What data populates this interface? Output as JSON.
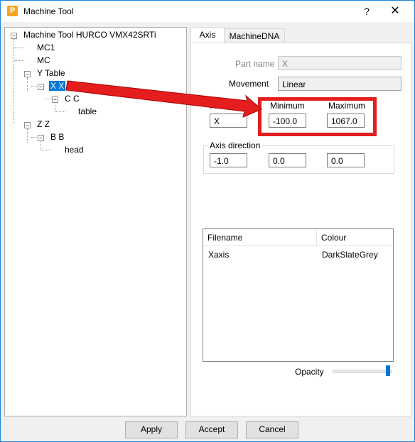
{
  "window": {
    "title": "Machine Tool",
    "help": "?",
    "close": "✕"
  },
  "tree": {
    "root": "Machine Tool HURCO VMX42SRTi",
    "mc1": "MC1",
    "mc": "MC",
    "y_table": "Y Table",
    "x_x": "X X",
    "c_c": "C C",
    "table": "table",
    "z_z": "Z Z",
    "b_b": "B B",
    "head": "head"
  },
  "tabs": {
    "axis": "Axis",
    "machine_dna": "MachineDNA"
  },
  "axis": {
    "part_name_label": "Part name",
    "part_name_value": "X",
    "movement_label": "Movement",
    "movement_value": "Linear",
    "address_label": "Address",
    "address_value": "X",
    "minimum_label": "Minimum",
    "minimum_value": "-100.0",
    "maximum_label": "Maximum",
    "maximum_value": "1067.0",
    "axis_direction_label": "Axis direction",
    "dir_x": "-1.0",
    "dir_y": "0.0",
    "dir_z": "0.0"
  },
  "files_table": {
    "headers": [
      "Filename",
      "Colour"
    ],
    "rows": [
      [
        "Xaxis",
        "DarkSlateGrey"
      ]
    ]
  },
  "opacity": {
    "label": "Opacity",
    "value": 1.0
  },
  "buttons": {
    "apply": "Apply",
    "accept": "Accept",
    "cancel": "Cancel"
  },
  "colors": {
    "accent": "#0078d7",
    "annotation": "#e41e1e"
  }
}
